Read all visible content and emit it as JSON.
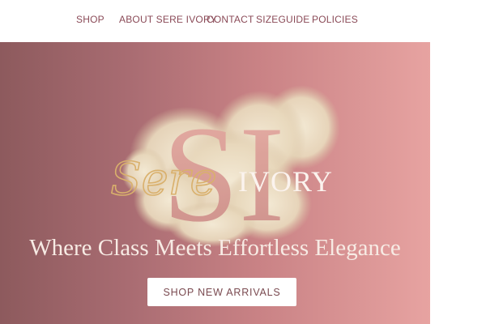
{
  "nav": {
    "items": [
      {
        "label": "SHOP"
      },
      {
        "label": "ABOUT SERE IVORY"
      },
      {
        "label": "CONTACT"
      },
      {
        "label": "SIZEGUIDE"
      },
      {
        "label": "POLICIES"
      }
    ]
  },
  "hero": {
    "logo": {
      "monogram": "SI",
      "script_word": "Sere",
      "word": "IVORY",
      "first_letter": "I"
    },
    "tagline": "Where Class Meets Effortless Elegance",
    "cta_label": "SHOP NEW ARRIVALS"
  },
  "colors": {
    "nav_text": "#8a4a57",
    "hero_gradient_start": "#8d5a5d",
    "hero_gradient_end": "#e7a3a1",
    "monogram": "#d49a92",
    "script_gold": "#d9b06c",
    "smoke": "#eadcc2",
    "tagline": "#f7ebe4",
    "cta_text": "#7a4a50"
  }
}
